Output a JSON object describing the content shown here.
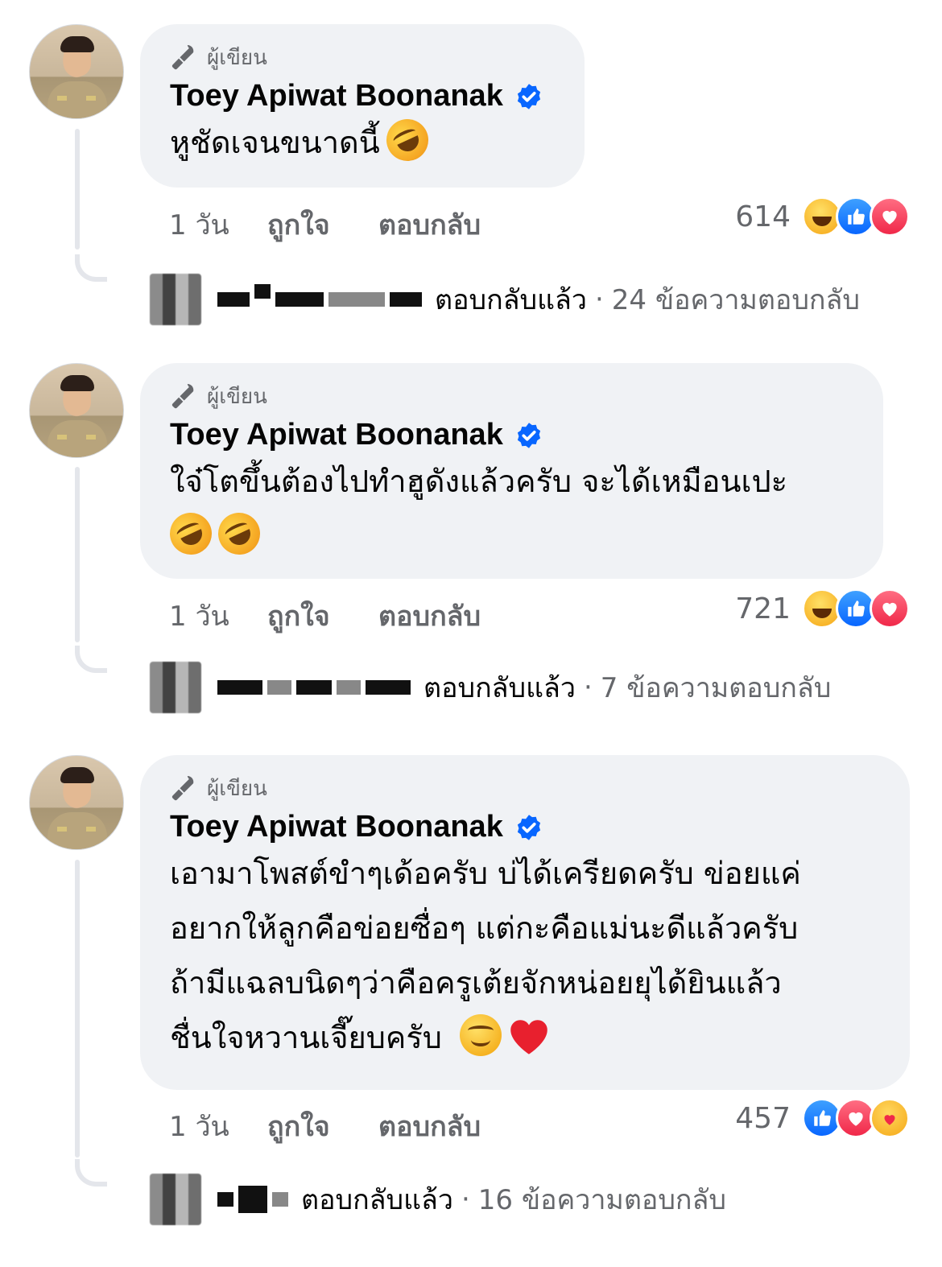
{
  "comments": [
    {
      "author_tag": "ผู้เขียน",
      "author_name": "Toey Apiwat Boonanak",
      "text": "หูชัดเจนขนาดนี้",
      "emojis": [
        "rofl"
      ],
      "time": "1 วัน",
      "like_label": "ถูกใจ",
      "reply_label": "ตอบกลับ",
      "reaction_count": "614",
      "reaction_types": [
        "haha",
        "like",
        "love"
      ],
      "replied_label": "ตอบกลับแล้ว",
      "separator": "·",
      "reply_count": "24 ข้อความตอบกลับ"
    },
    {
      "author_tag": "ผู้เขียน",
      "author_name": "Toey Apiwat Boonanak",
      "text": "ใจ๋โตขึ้นต้องไปทำฮูดังแล้วครับ จะได้เหมือนเปะ",
      "emojis": [
        "rofl",
        "rofl"
      ],
      "time": "1 วัน",
      "like_label": "ถูกใจ",
      "reply_label": "ตอบกลับ",
      "reaction_count": "721",
      "reaction_types": [
        "haha",
        "like",
        "love"
      ],
      "replied_label": "ตอบกลับแล้ว",
      "separator": "·",
      "reply_count": "7 ข้อความตอบกลับ"
    },
    {
      "author_tag": "ผู้เขียน",
      "author_name": "Toey Apiwat Boonanak",
      "text_lines": [
        "เอามาโพสต์ขำๆเด้อครับ บ่ได้เครียดครับ ข่อยแค่",
        "อยากให้ลูกคือข่อยซื่อๆ แต่กะคือแม่นะดีแล้วครับ",
        "ถ้ามีแฉลบนิดๆว่าคือครูเต้ยจักหน่อยยุได้ยินแล้ว",
        "ชื่นใจหวานเจี๊ยบครับ"
      ],
      "emojis": [
        "smile",
        "heart"
      ],
      "time": "1 วัน",
      "like_label": "ถูกใจ",
      "reply_label": "ตอบกลับ",
      "reaction_count": "457",
      "reaction_types": [
        "like",
        "love",
        "care"
      ],
      "replied_label": "ตอบกลับแล้ว",
      "separator": "·",
      "reply_count": "16 ข้อความตอบกลับ"
    }
  ],
  "colors": {
    "bubble": "#f0f2f5",
    "secondary_text": "#65676b",
    "verified": "#0866ff",
    "thread_line": "#e4e6eb"
  }
}
